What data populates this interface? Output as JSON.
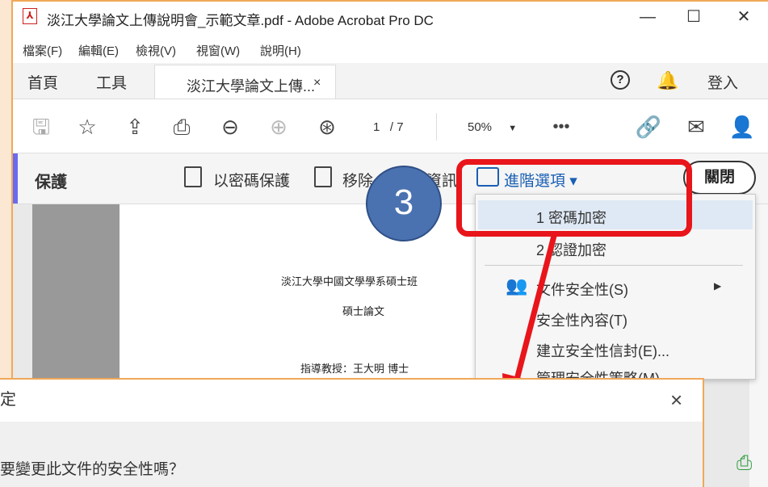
{
  "window": {
    "title": "淡江大學論文上傳說明會_示範文章.pdf - Adobe Acrobat Pro DC",
    "controls": {
      "minimize": "—",
      "maximize": "☐",
      "close": "✕"
    }
  },
  "menu": [
    "檔案(F)",
    "編輯(E)",
    "檢視(V)",
    "視窗(W)",
    "說明(H)"
  ],
  "tabs": {
    "home": "首頁",
    "tools": "工具",
    "document": "淡江大學論文上傳...",
    "document_close": "×"
  },
  "topright": {
    "help": "?",
    "login": "登入"
  },
  "toolbar": {
    "page_current": "1",
    "page_total": "/ 7",
    "zoom": "50%"
  },
  "protect": {
    "title": "保護",
    "password_protect": "以密碼保護",
    "remove": "移除",
    "remove_tail": "資訊",
    "advanced": "進階選項 ▾",
    "close": "關閉"
  },
  "dropdown": {
    "items": [
      "1 密碼加密",
      "2 認證加密",
      "文件安全性(S)",
      "安全性內容(T)",
      "建立安全性信封(E)...",
      "管理安全性策略(M)..."
    ]
  },
  "document": {
    "line1": "淡江大學中國文學學系碩士班",
    "line2": "碩士論文",
    "line3": "指導教授：王大明 博士"
  },
  "callout": {
    "step": "3"
  },
  "dialog": {
    "title": "定",
    "text": "要變更此文件的安全性嗎？",
    "close": "×"
  },
  "colors": {
    "callout_red": "#e8151b",
    "step_circle": "#4a72b0",
    "accent": "#1a5fb4",
    "window_border": "#f0a858"
  }
}
